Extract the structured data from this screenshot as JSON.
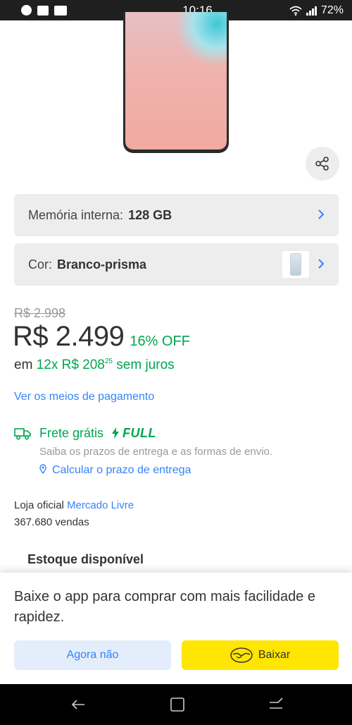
{
  "status_bar": {
    "time": "10:16",
    "battery": "72%",
    "left_icons": [
      "messenger-icon",
      "mail-icon",
      "outlook-icon"
    ],
    "right_icons": [
      "wifi-icon",
      "signal-icon"
    ]
  },
  "product": {
    "share_icon": "share-icon"
  },
  "variations": [
    {
      "label": "Memória interna:",
      "value": "128 GB"
    },
    {
      "label": "Cor:",
      "value": "Branco-prisma"
    }
  ],
  "price": {
    "original": "R$ 2.998",
    "current": "R$ 2.499",
    "discount": "16% OFF",
    "installment_prefix": "em",
    "installment_main": "12x R$ 208",
    "installment_cents": "25",
    "installment_suffix": "sem juros"
  },
  "payment_link": "Ver os meios de pagamento",
  "shipping": {
    "title": "Frete grátis",
    "badge": "FULL",
    "description": "Saiba os prazos de entrega e as formas de envio.",
    "calc_link": "Calcular o prazo de entrega"
  },
  "store": {
    "prefix": "Loja oficial",
    "name": "Mercado Livre",
    "sales": "367.680 vendas"
  },
  "stock": "Estoque disponível",
  "banner": {
    "text": "Baixe o app para comprar com mais facilidade e rapidez.",
    "later_label": "Agora não",
    "download_label": "Baixar"
  },
  "colors": {
    "green": "#00a650",
    "blue": "#3483fa",
    "yellow": "#fee600"
  }
}
